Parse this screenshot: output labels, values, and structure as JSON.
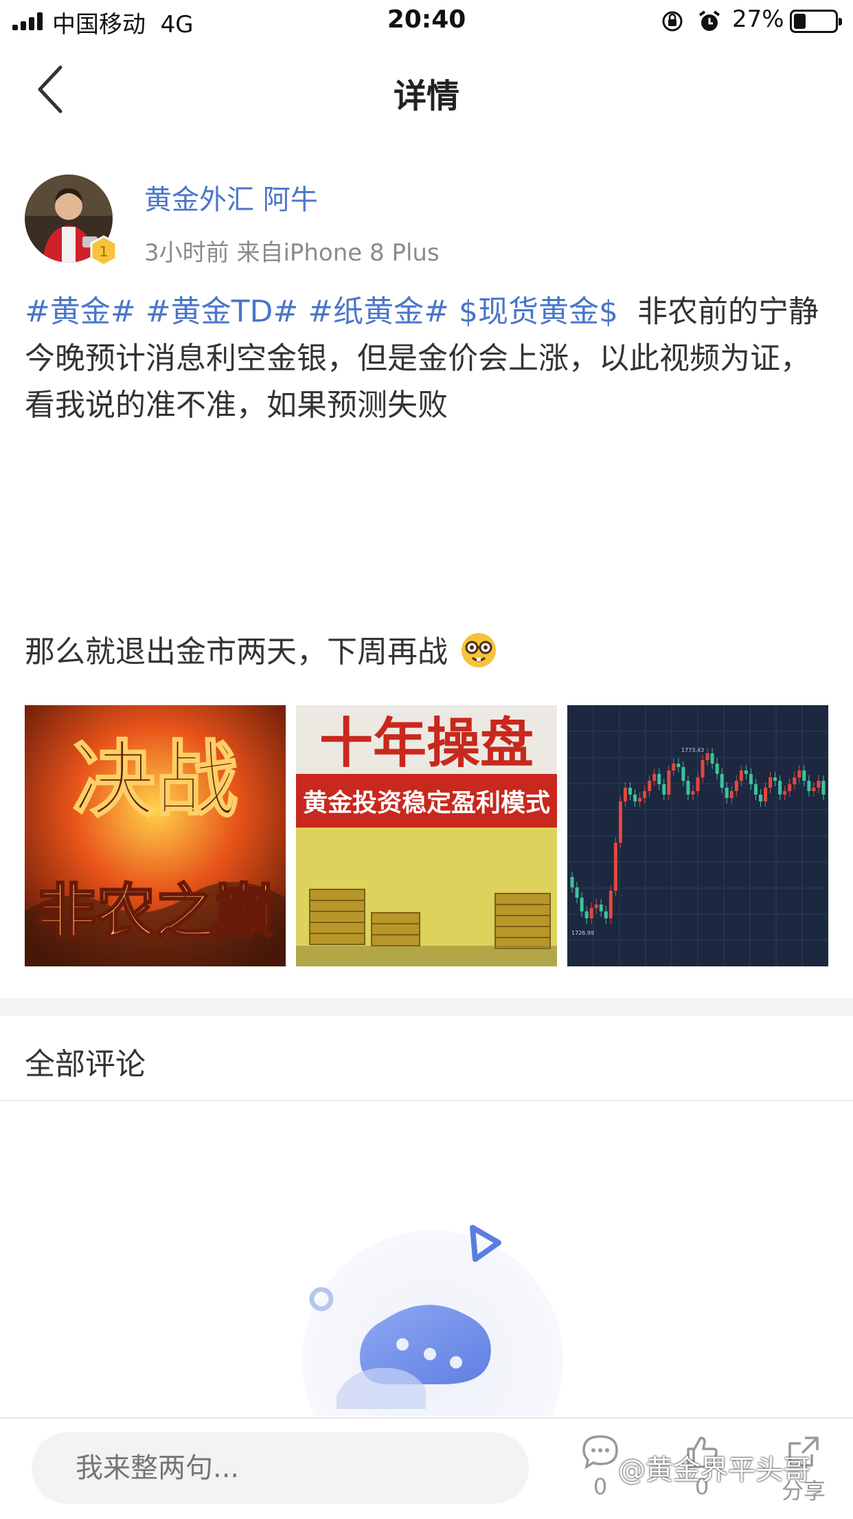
{
  "status": {
    "carrier": "中国移动",
    "network": "4G",
    "time": "20:40",
    "battery": "27%"
  },
  "nav": {
    "title": "详情"
  },
  "author": {
    "name": "黄金外汇 阿牛",
    "meta": "3小时前  来自iPhone 8 Plus",
    "level": "1"
  },
  "post": {
    "tags": [
      "#黄金#",
      "#黄金TD#",
      "#纸黄金#",
      "$现货黄金$"
    ],
    "text1": "非农前的宁静",
    "text2": "今晚预计消息利空金银，但是金价会上涨，以此视频为证，看我说的准不准，如果预测失败",
    "text3": "那么就退出金市两天，下周再战",
    "emoji": "nerd-face-icon"
  },
  "images": {
    "img1_text_top": "决战",
    "img1_text_bottom": "非农之巅",
    "img2_text_top": "十年操盘",
    "img2_text_banner": "黄金投资稳定盈利模式",
    "img3_label_high": "1773.43",
    "img3_label_low": "1726.99"
  },
  "comments": {
    "title": "全部评论"
  },
  "bottom": {
    "input_placeholder": "我来整两句...",
    "comment_count": "0",
    "like_count": "0",
    "share_label": "分享",
    "watermark": "@黄金界平头哥"
  },
  "colors": {
    "link": "#4a76c9",
    "chart_bg": "#1c2840",
    "up": "#e0493f",
    "down": "#3cc39a"
  }
}
